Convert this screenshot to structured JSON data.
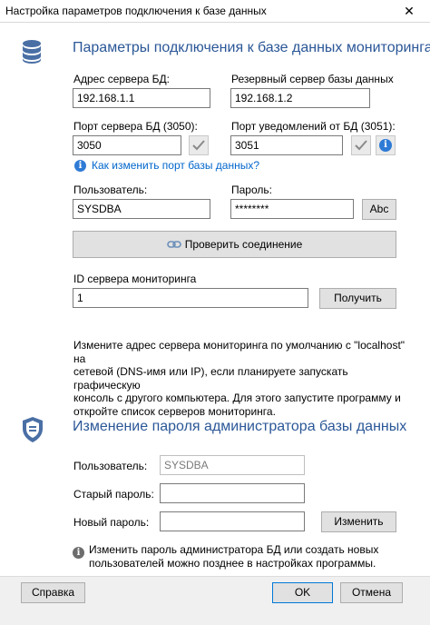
{
  "window": {
    "title": "Настройка параметров подключения к базе данных",
    "close_glyph": "✕"
  },
  "db_section": {
    "title": "Параметры подключения к базе данных мониторинга",
    "server_label": "Адрес сервера БД:",
    "server_value": "192.168.1.1",
    "backup_label": "Резервный сервер базы данных",
    "backup_value": "192.168.1.2",
    "port_label": "Порт сервера БД (3050):",
    "port_value": "3050",
    "notify_port_label": "Порт уведомлений от БД (3051):",
    "notify_port_value": "3051",
    "change_port_link": "Как изменить порт базы данных?",
    "user_label": "Пользователь:",
    "user_value": "SYSDBA",
    "password_label": "Пароль:",
    "password_value": "********",
    "show_password_button": "Abc",
    "test_connection_button": "Проверить соединение",
    "server_id_label": "ID сервера мониторинга",
    "server_id_value": "1",
    "get_button": "Получить",
    "hint_lines": [
      "Измените адрес сервера мониторинга по умолчанию с \"localhost\" на",
      "сетевой (DNS-имя или IP), если планируете запускать графическую",
      "консоль с другого компьютера. Для этого запустите программу и",
      "откройте список серверов мониторинга."
    ]
  },
  "admin_section": {
    "title": "Изменение пароля администратора базы данных",
    "user_label": "Пользователь:",
    "user_value": "SYSDBA",
    "old_password_label": "Старый пароль:",
    "old_password_value": "",
    "new_password_label": "Новый пароль:",
    "new_password_value": "",
    "change_button": "Изменить",
    "info_lines": [
      "Изменить пароль администратора БД или создать новых",
      "пользователей можно позднее в настройках программы."
    ]
  },
  "footer": {
    "help_button": "Справка",
    "ok_button": "OK",
    "cancel_button": "Отмена"
  },
  "colors": {
    "section_title": "#2b5797",
    "link": "#0066cc",
    "accent_border": "#0078d7"
  },
  "icons": {
    "db_section": "database-icon",
    "admin_section": "shield-icon",
    "connect": "link-icon",
    "confirm": "checkmark-icon",
    "info": "info-icon"
  }
}
